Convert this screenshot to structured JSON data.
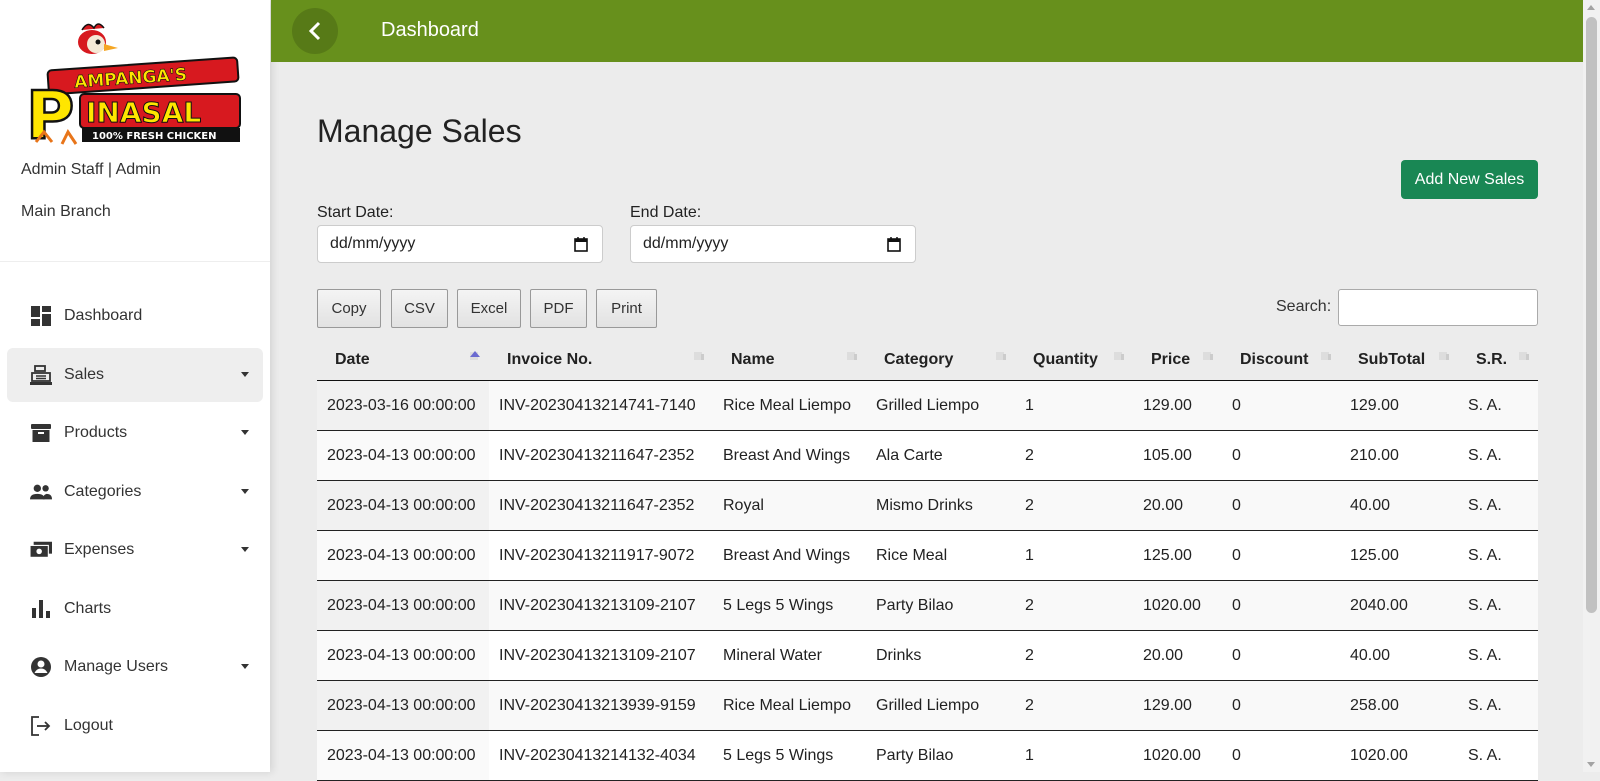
{
  "sidebar": {
    "logo": {
      "line1": "AMPANGA'S",
      "line2": "INASAL",
      "tagline": "100% FRESH CHICKEN",
      "letter": "P"
    },
    "user": "Admin Staff | Admin",
    "branch": "Main Branch",
    "items": [
      {
        "label": "Dashboard",
        "icon": "dashboard-icon"
      },
      {
        "label": "Sales",
        "icon": "cash-register-icon"
      },
      {
        "label": "Products",
        "icon": "archive-box-icon"
      },
      {
        "label": "Categories",
        "icon": "people-icon"
      },
      {
        "label": "Expenses",
        "icon": "money-icon"
      },
      {
        "label": "Charts",
        "icon": "bar-chart-icon"
      },
      {
        "label": "Manage Users",
        "icon": "account-circle-icon"
      },
      {
        "label": "Logout",
        "icon": "logout-icon"
      }
    ]
  },
  "header": {
    "title": "Dashboard"
  },
  "main": {
    "title": "Manage Sales",
    "add_button": "Add New Sales",
    "start_label": "Start Date:",
    "end_label": "End Date:",
    "start_value": "dd/mm/yyyy",
    "end_value": "dd/mm/yyyy",
    "export_buttons": [
      "Copy",
      "CSV",
      "Excel",
      "PDF",
      "Print"
    ],
    "search_label": "Search:"
  },
  "table": {
    "columns": [
      "Date",
      "Invoice No.",
      "Name",
      "Category",
      "Quantity",
      "Price",
      "Discount",
      "SubTotal",
      "S.R."
    ],
    "rows": [
      [
        "2023-03-16 00:00:00",
        "INV-20230413214741-7140",
        "Rice Meal Liempo",
        "Grilled Liempo",
        "1",
        "129.00",
        "0",
        "129.00",
        "S. A."
      ],
      [
        "2023-04-13 00:00:00",
        "INV-20230413211647-2352",
        "Breast And Wings",
        "Ala Carte",
        "2",
        "105.00",
        "0",
        "210.00",
        "S. A."
      ],
      [
        "2023-04-13 00:00:00",
        "INV-20230413211647-2352",
        "Royal",
        "Mismo Drinks",
        "2",
        "20.00",
        "0",
        "40.00",
        "S. A."
      ],
      [
        "2023-04-13 00:00:00",
        "INV-20230413211917-9072",
        "Breast And Wings",
        "Rice Meal",
        "1",
        "125.00",
        "0",
        "125.00",
        "S. A."
      ],
      [
        "2023-04-13 00:00:00",
        "INV-20230413213109-2107",
        "5 Legs 5 Wings",
        "Party Bilao",
        "2",
        "1020.00",
        "0",
        "2040.00",
        "S. A."
      ],
      [
        "2023-04-13 00:00:00",
        "INV-20230413213109-2107",
        "Mineral Water",
        "Drinks",
        "2",
        "20.00",
        "0",
        "40.00",
        "S. A."
      ],
      [
        "2023-04-13 00:00:00",
        "INV-20230413213939-9159",
        "Rice Meal Liempo",
        "Grilled Liempo",
        "2",
        "129.00",
        "0",
        "258.00",
        "S. A."
      ],
      [
        "2023-04-13 00:00:00",
        "INV-20230413214132-4034",
        "5 Legs 5 Wings",
        "Party Bilao",
        "1",
        "1020.00",
        "0",
        "1020.00",
        "S. A."
      ]
    ]
  },
  "colors": {
    "header": "#67901c",
    "add_button": "#198754",
    "logo_red": "#d7191f",
    "logo_yellow": "#ffe600"
  }
}
